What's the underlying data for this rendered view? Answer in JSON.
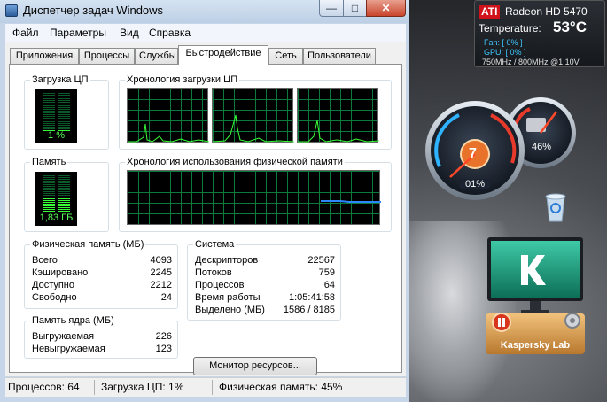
{
  "window": {
    "title": "Диспетчер задач Windows",
    "controls": {
      "minimize": "—",
      "maximize": "□",
      "close": "✕"
    }
  },
  "menu": [
    "Файл",
    "Параметры",
    "Вид",
    "Справка"
  ],
  "tabs": [
    "Приложения",
    "Процессы",
    "Службы",
    "Быстродействие",
    "Сеть",
    "Пользователи"
  ],
  "active_tab": "Быстродействие",
  "performance": {
    "cpu_usage_label": "Загрузка ЦП",
    "cpu_usage_value": "1 %",
    "cpu_history_label": "Хронология загрузки ЦП",
    "memory_label": "Память",
    "memory_value": "1,83 ГБ",
    "memory_history_label": "Хронология использования физической памяти",
    "physical_memory": {
      "title": "Физическая память (МБ)",
      "rows": [
        {
          "label": "Всего",
          "value": "4093"
        },
        {
          "label": "Кэшировано",
          "value": "2245"
        },
        {
          "label": "Доступно",
          "value": "2212"
        },
        {
          "label": "Свободно",
          "value": "24"
        }
      ]
    },
    "kernel_memory": {
      "title": "Память ядра (МБ)",
      "rows": [
        {
          "label": "Выгружаемая",
          "value": "226"
        },
        {
          "label": "Невыгружаемая",
          "value": "123"
        }
      ]
    },
    "system": {
      "title": "Система",
      "rows": [
        {
          "label": "Дескрипторов",
          "value": "22567"
        },
        {
          "label": "Потоков",
          "value": "759"
        },
        {
          "label": "Процессов",
          "value": "64"
        },
        {
          "label": "Время работы",
          "value": "1:05:41:58"
        },
        {
          "label": "Выделено (МБ)",
          "value": "1586 / 8185"
        }
      ]
    },
    "resource_monitor_button": "Монитор ресурсов..."
  },
  "statusbar": {
    "processes": "Процессов: 64",
    "cpu": "Загрузка ЦП: 1%",
    "memory": "Физическая память: 45%"
  },
  "gadgets": {
    "ati": {
      "logo": "ATI",
      "model": "Radeon HD 5470",
      "temperature_label": "Temperature:",
      "temperature_value": "53°C",
      "fan": "Fan: [ 0% ]",
      "gpu": "GPU: [ 0% ]",
      "clock": "750MHz / 800MHz @1.10V"
    },
    "cpu_meter": {
      "cpu_percent": "01%",
      "memory_percent": "46%",
      "gauge_digit": "7"
    },
    "kaspersky": {
      "label": "Kaspersky Lab",
      "pause_icon": "pause-icon",
      "gear_icon": "gear-icon"
    }
  },
  "colors": {
    "graph_line": "#39ff39",
    "graph_grid": "#0a7a3a",
    "memory_line": "#2e86ff",
    "accent_orange": "#e8722a"
  }
}
